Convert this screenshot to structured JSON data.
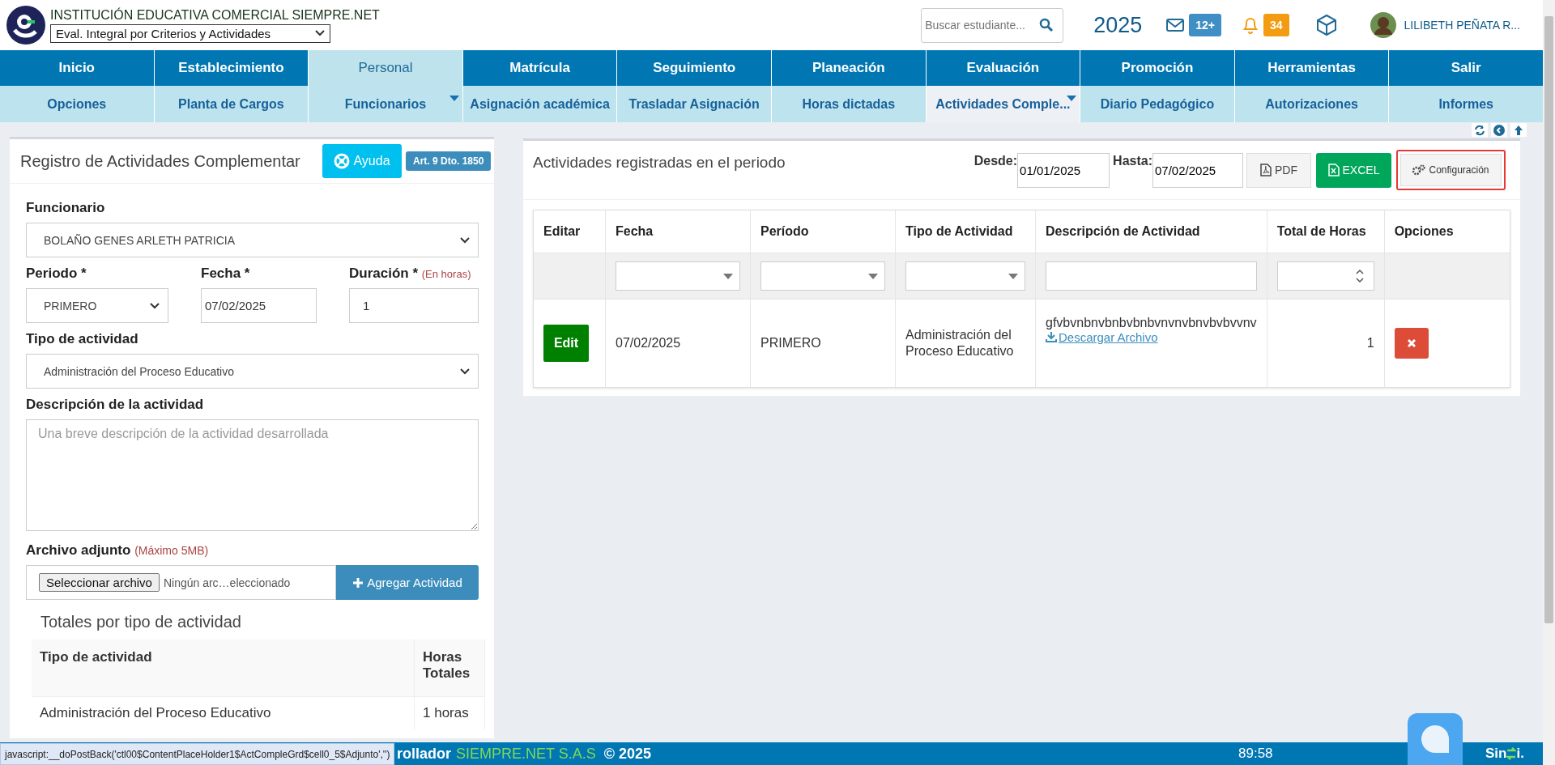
{
  "header": {
    "school": "INSTITUCIÓN EDUCATIVA COMERCIAL SIEMPRE.NET",
    "mode_select": "Eval. Integral por Criterios y Actividades",
    "search_placeholder": "Buscar estudiante...",
    "year": "2025",
    "messages_badge": "12+",
    "alerts_badge": "34",
    "user": "LILIBETH PEÑATA R..."
  },
  "menu": [
    {
      "label": "Inicio",
      "selected": false
    },
    {
      "label": "Establecimiento",
      "selected": false
    },
    {
      "label": "Personal",
      "selected": true
    },
    {
      "label": "Matrícula",
      "selected": false
    },
    {
      "label": "Seguimiento",
      "selected": false
    },
    {
      "label": "Planeación",
      "selected": false
    },
    {
      "label": "Evaluación",
      "selected": false
    },
    {
      "label": "Promoción",
      "selected": false
    },
    {
      "label": "Herramientas",
      "selected": false
    },
    {
      "label": "Salir",
      "selected": false
    }
  ],
  "submenu": [
    {
      "label": "Opciones",
      "selected": false,
      "dropdown": false
    },
    {
      "label": "Planta de Cargos",
      "selected": false,
      "dropdown": false
    },
    {
      "label": "Funcionarios",
      "selected": false,
      "dropdown": true
    },
    {
      "label": "Asignación académica",
      "selected": false,
      "dropdown": false
    },
    {
      "label": "Trasladar Asignación",
      "selected": false,
      "dropdown": false
    },
    {
      "label": "Horas dictadas",
      "selected": false,
      "dropdown": false
    },
    {
      "label": "Actividades Comple...",
      "selected": true,
      "dropdown": true
    },
    {
      "label": "Diario Pedagógico",
      "selected": false,
      "dropdown": false
    },
    {
      "label": "Autorizaciones",
      "selected": false,
      "dropdown": false
    },
    {
      "label": "Informes",
      "selected": false,
      "dropdown": false
    }
  ],
  "form": {
    "title": "Registro de Actividades Complementar",
    "help_button": "Ayuda",
    "law_badge": "Art. 9 Dto. 1850",
    "funcionario": {
      "label": "Funcionario",
      "value": "BOLAÑO GENES ARLETH PATRICIA"
    },
    "periodo": {
      "label": "Periodo *",
      "value": "PRIMERO"
    },
    "fecha": {
      "label": "Fecha *",
      "value": "07/02/2025"
    },
    "duracion": {
      "label": "Duración *",
      "hint": "(En horas)",
      "value": "1"
    },
    "tipo": {
      "label": "Tipo de actividad",
      "value": "Administración del Proceso Educativo"
    },
    "descripcion": {
      "label": "Descripción de la actividad",
      "placeholder": "Una breve descripción de la actividad desarrollada"
    },
    "archivo": {
      "label": "Archivo adjunto",
      "hint": "(Máximo 5MB)",
      "button": "Seleccionar archivo",
      "status": "Ningún arc…eleccionado"
    },
    "add_button": "Agregar Actividad",
    "totals": {
      "title": "Totales por tipo de actividad",
      "columns": [
        "Tipo de actividad",
        "Horas Totales"
      ],
      "rows": [
        [
          "Administración del Proceso Educativo",
          "1 horas"
        ]
      ]
    }
  },
  "activities": {
    "title": "Actividades registradas en el periodo",
    "desde_label": "Desde:",
    "desde": "01/01/2025",
    "hasta_label": "Hasta:",
    "hasta": "07/02/2025",
    "pdf_button": "PDF",
    "excel_button": "EXCEL",
    "config_button": "Configuración",
    "config_highlighted": true,
    "columns": [
      "Editar",
      "Fecha",
      "Período",
      "Tipo de Actividad",
      "Descripción de Actividad",
      "Total de Horas",
      "Opciones"
    ],
    "rows": [
      {
        "edit": "Edit",
        "fecha": "07/02/2025",
        "periodo": "PRIMERO",
        "tipo": "Administración del Proceso Educativo",
        "descripcion": "gfvbvnbnvbnbvbnbvnvnvbnvbvbvvnv",
        "download": "Descargar Archivo",
        "total": "1"
      }
    ]
  },
  "status_url": "javascript:__doPostBack('ctl00$ContentPlaceHolder1$ActCompleGrd$cell0_5$Adjunto','')",
  "footer": {
    "text_start": "rollador",
    "company": "SIEMPRE.NET S.A.S",
    "copyright": "© 2025",
    "timer": "89:58",
    "brand": "Sin",
    "brand_end": "i."
  }
}
